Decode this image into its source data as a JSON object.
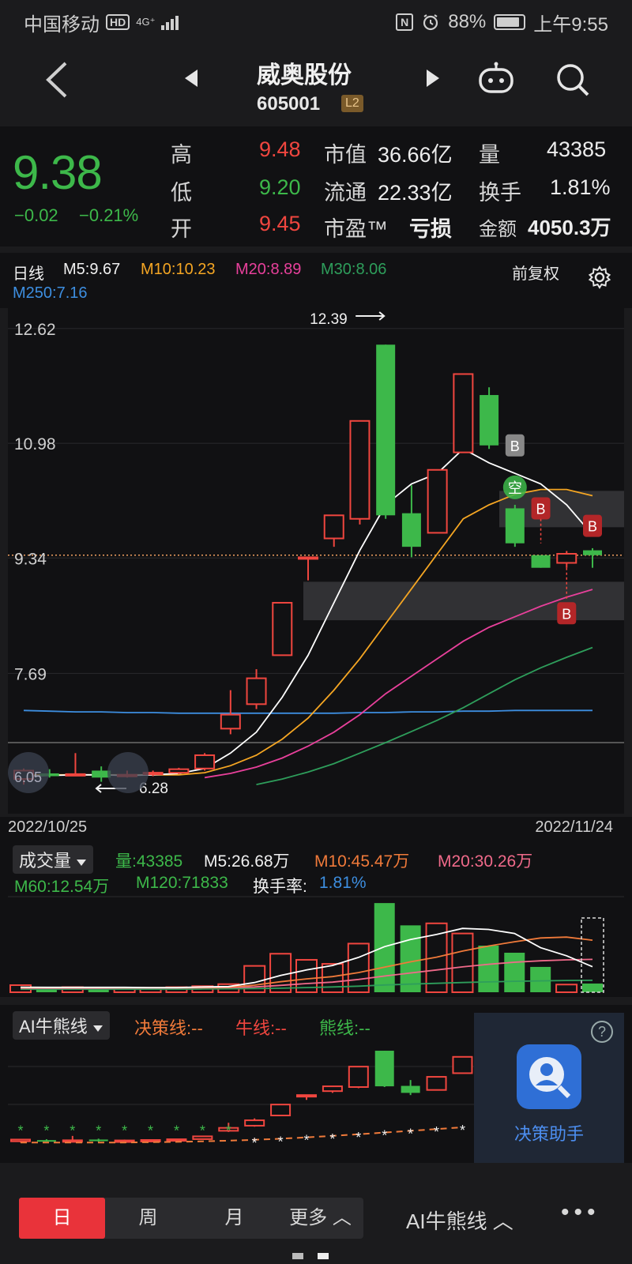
{
  "status": {
    "carrier": "中国移动",
    "hd": "HD",
    "net": "4G⁺",
    "nfc": "N",
    "battery": "88%",
    "time": "上午9:55"
  },
  "header": {
    "back_icon": "chevron-left-icon",
    "title": "威奥股份",
    "code": "605001",
    "level": "L2"
  },
  "quote": {
    "price": "9.38",
    "change": "−0.02",
    "change_pct": "−0.21%",
    "high_label": "高",
    "high": "9.48",
    "low_label": "低",
    "low": "9.20",
    "open_label": "开",
    "open": "9.45",
    "mcap_label": "市值",
    "mcap": "36.66亿",
    "float_label": "流通",
    "float": "22.33亿",
    "pe_label": "市盈™",
    "pe": "亏损",
    "vol_label": "量",
    "vol": "43385",
    "turnover_label": "换手",
    "turnover": "1.81%",
    "amount_label": "金额",
    "amount": "4050.3万"
  },
  "chart_header": {
    "period": "日线",
    "m5": "M5:9.67",
    "m10": "M10:10.23",
    "m20": "M20:8.89",
    "m30": "M30:8.06",
    "m250": "M250:7.16",
    "adjust": "前复权"
  },
  "colors": {
    "up": "#f0463f",
    "down": "#3db84a",
    "m5": "#ffffff",
    "m10": "#f5a623",
    "m20": "#e8409b",
    "m30": "#2e9e5b",
    "m250": "#3d8ee0"
  },
  "chart_data": {
    "type": "candlestick",
    "y_ticks": [
      "12.62",
      "10.98",
      "9.34",
      "7.69"
    ],
    "annotations": {
      "high_label": "12.39",
      "low_label": "6.28",
      "low_left": "6.05",
      "markers": [
        "B",
        "空",
        "B",
        "B",
        "B"
      ]
    },
    "x_start": "2022/10/25",
    "x_end": "2022/11/24",
    "candles": [
      {
        "o": 6.3,
        "c": 6.18,
        "h": 6.33,
        "l": 6.1,
        "up": true
      },
      {
        "o": 6.22,
        "c": 6.26,
        "h": 6.32,
        "l": 6.2,
        "up": false
      },
      {
        "o": 6.25,
        "c": 6.24,
        "h": 6.55,
        "l": 6.22,
        "up": true
      },
      {
        "o": 6.3,
        "c": 6.2,
        "h": 6.36,
        "l": 6.14,
        "up": false
      },
      {
        "o": 6.22,
        "c": 6.24,
        "h": 6.3,
        "l": 6.2,
        "up": true
      },
      {
        "o": 6.25,
        "c": 6.27,
        "h": 6.3,
        "l": 6.22,
        "up": true
      },
      {
        "o": 6.27,
        "c": 6.32,
        "h": 6.34,
        "l": 6.25,
        "up": true
      },
      {
        "o": 6.33,
        "c": 6.52,
        "h": 6.55,
        "l": 6.3,
        "up": true
      },
      {
        "o": 6.9,
        "c": 7.1,
        "h": 7.45,
        "l": 6.82,
        "up": true
      },
      {
        "o": 7.25,
        "c": 7.62,
        "h": 7.75,
        "l": 7.18,
        "up": true
      },
      {
        "o": 7.95,
        "c": 8.7,
        "h": 8.7,
        "l": 7.95,
        "up": true
      },
      {
        "o": 9.35,
        "c": 9.35,
        "h": 9.35,
        "l": 9.02,
        "up": true
      },
      {
        "o": 9.62,
        "c": 9.95,
        "h": 9.95,
        "l": 9.5,
        "up": true
      },
      {
        "o": 9.9,
        "c": 11.3,
        "h": 11.3,
        "l": 9.82,
        "up": true
      },
      {
        "o": 12.39,
        "c": 9.95,
        "h": 12.39,
        "l": 9.9,
        "up": false
      },
      {
        "o": 9.98,
        "c": 9.5,
        "h": 10.38,
        "l": 9.35,
        "up": false
      },
      {
        "o": 9.7,
        "c": 10.6,
        "h": 10.6,
        "l": 9.7,
        "up": true
      },
      {
        "o": 10.85,
        "c": 11.97,
        "h": 11.97,
        "l": 10.85,
        "up": true
      },
      {
        "o": 11.67,
        "c": 10.95,
        "h": 11.78,
        "l": 10.9,
        "up": false
      },
      {
        "o": 10.05,
        "c": 9.55,
        "h": 10.1,
        "l": 9.5,
        "up": false
      },
      {
        "o": 9.38,
        "c": 9.2,
        "h": 9.38,
        "l": 9.2,
        "up": false
      },
      {
        "o": 9.27,
        "c": 9.4,
        "h": 9.44,
        "l": 9.2,
        "up": true
      },
      {
        "o": 9.45,
        "c": 9.38,
        "h": 9.48,
        "l": 9.2,
        "up": false
      }
    ],
    "m5": [
      6.22,
      6.23,
      6.24,
      6.24,
      6.23,
      6.24,
      6.26,
      6.33,
      6.55,
      6.85,
      7.35,
      7.95,
      8.7,
      9.45,
      10.1,
      10.4,
      10.55,
      10.9,
      10.7,
      10.55,
      10.4,
      10.1,
      9.67
    ],
    "m10": [
      6.24,
      6.24,
      6.24,
      6.24,
      6.24,
      6.24,
      6.24,
      6.27,
      6.37,
      6.52,
      6.75,
      7.05,
      7.45,
      7.9,
      8.4,
      8.9,
      9.4,
      9.9,
      10.1,
      10.25,
      10.32,
      10.32,
      10.23
    ],
    "m20": [
      null,
      null,
      null,
      null,
      null,
      null,
      null,
      6.2,
      6.26,
      6.35,
      6.48,
      6.65,
      6.85,
      7.1,
      7.4,
      7.65,
      7.9,
      8.15,
      8.35,
      8.5,
      8.65,
      8.78,
      8.89
    ],
    "m30": [
      null,
      null,
      null,
      null,
      null,
      null,
      null,
      null,
      null,
      6.1,
      6.18,
      6.28,
      6.4,
      6.55,
      6.7,
      6.86,
      7.02,
      7.2,
      7.4,
      7.6,
      7.77,
      7.92,
      8.06
    ],
    "m250": [
      7.16,
      7.15,
      7.14,
      7.14,
      7.13,
      7.13,
      7.12,
      7.12,
      7.12,
      7.12,
      7.12,
      7.12,
      7.12,
      7.13,
      7.13,
      7.14,
      7.14,
      7.15,
      7.15,
      7.16,
      7.16,
      7.16,
      7.16
    ],
    "ylim": [
      6.0,
      12.8
    ]
  },
  "volume": {
    "selector": "成交量",
    "q": "量:43385",
    "m5": "M5:26.68万",
    "m10": "M10:45.47万",
    "m20": "M20:30.26万",
    "m60": "M60:12.54万",
    "m120": "M120:71833",
    "turnover_label": "换手率:",
    "turnover": "1.81%",
    "bars_wan": [
      3.5,
      2.0,
      2.5,
      2.0,
      2.2,
      2.0,
      2.5,
      3.0,
      4.0,
      13.0,
      19.0,
      16.0,
      14.0,
      24.0,
      44.0,
      33.0,
      34.0,
      29.0,
      23.0,
      19.5,
      12.5,
      3.8,
      4.3
    ],
    "m5_line": [
      2.5,
      2.4,
      2.4,
      2.4,
      2.4,
      2.3,
      2.3,
      2.6,
      2.8,
      4.8,
      8.3,
      11.0,
      13.2,
      17.2,
      22.5,
      26.0,
      28.5,
      31.5,
      31.0,
      29.0,
      22.0,
      18.0,
      12.6
    ],
    "m10_line": [
      2.3,
      2.3,
      2.3,
      2.3,
      2.3,
      2.3,
      2.3,
      2.4,
      2.5,
      3.5,
      5.2,
      6.6,
      7.7,
      9.7,
      12.4,
      15.0,
      17.3,
      20.3,
      22.8,
      24.9,
      26.8,
      27.2,
      25.7
    ],
    "m20_line": [
      2.0,
      2.0,
      2.0,
      2.0,
      2.1,
      2.1,
      2.1,
      2.2,
      2.3,
      2.6,
      3.4,
      4.3,
      5.0,
      6.3,
      8.0,
      9.5,
      11.0,
      12.5,
      13.8,
      14.8,
      15.5,
      16.0,
      16.2
    ],
    "m60_line": [
      1.5,
      1.5,
      1.5,
      1.5,
      1.5,
      1.5,
      1.5,
      1.6,
      1.7,
      1.8,
      2.0,
      2.3,
      2.6,
      3.0,
      3.6,
      4.0,
      4.4,
      4.8,
      5.1,
      5.4,
      5.6,
      5.8,
      5.9
    ]
  },
  "ai": {
    "selector": "AI牛熊线",
    "decision": "决策线:--",
    "bull": "牛线:--",
    "bear": "熊线:--",
    "star": "*"
  },
  "assistant": {
    "label": "决策助手",
    "help": "?"
  },
  "bottom": {
    "tabs": [
      "日",
      "周",
      "月",
      "更多 ︿"
    ],
    "ai": "AI牛熊线 ︿",
    "more": "•••"
  }
}
